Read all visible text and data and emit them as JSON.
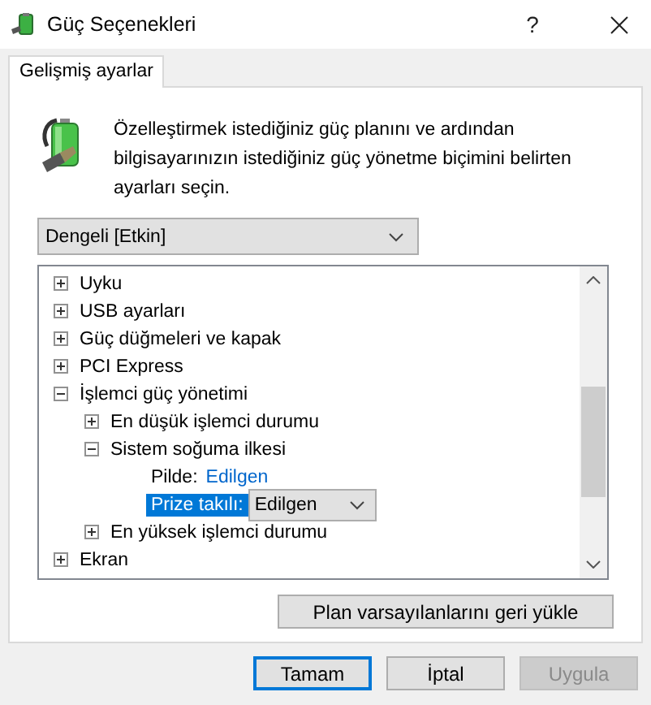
{
  "window": {
    "title": "Güç Seçenekleri",
    "help": "?"
  },
  "tabs": [
    {
      "label": "Gelişmiş ayarlar",
      "selected": true
    }
  ],
  "description": "Özelleştirmek istediğiniz güç planını ve ardından bilgisayarınızın istediğiniz güç yönetme biçimini belirten ayarları seçin.",
  "plan_dropdown": {
    "value": "Dengeli [Etkin]"
  },
  "tree": [
    {
      "kind": "node",
      "label": "Uyku",
      "expanded": false
    },
    {
      "kind": "node",
      "label": "USB ayarları",
      "expanded": false
    },
    {
      "kind": "node",
      "label": "Güç düğmeleri ve kapak",
      "expanded": false
    },
    {
      "kind": "node",
      "label": "PCI Express",
      "expanded": false
    },
    {
      "kind": "node",
      "label": "İşlemci güç yönetimi",
      "expanded": true,
      "children": [
        {
          "kind": "node",
          "label": "En düşük işlemci durumu",
          "expanded": false
        },
        {
          "kind": "node",
          "label": "Sistem soğuma ilkesi",
          "expanded": true,
          "children": [
            {
              "kind": "link_setting",
              "label": "Pilde:",
              "value": "Edilgen",
              "selected": false
            },
            {
              "kind": "dropdown_setting",
              "label": "Prize takılı:",
              "value": "Edilgen",
              "selected": true
            }
          ]
        },
        {
          "kind": "node",
          "label": "En yüksek işlemci durumu",
          "expanded": false
        }
      ]
    },
    {
      "kind": "node",
      "label": "Ekran",
      "expanded": false
    }
  ],
  "restore_button": "Plan varsayılanlarını geri yükle",
  "buttons": [
    {
      "label": "Tamam",
      "default": true,
      "disabled": false
    },
    {
      "label": "İptal",
      "default": false,
      "disabled": false
    },
    {
      "label": "Uygula",
      "default": false,
      "disabled": true
    }
  ]
}
